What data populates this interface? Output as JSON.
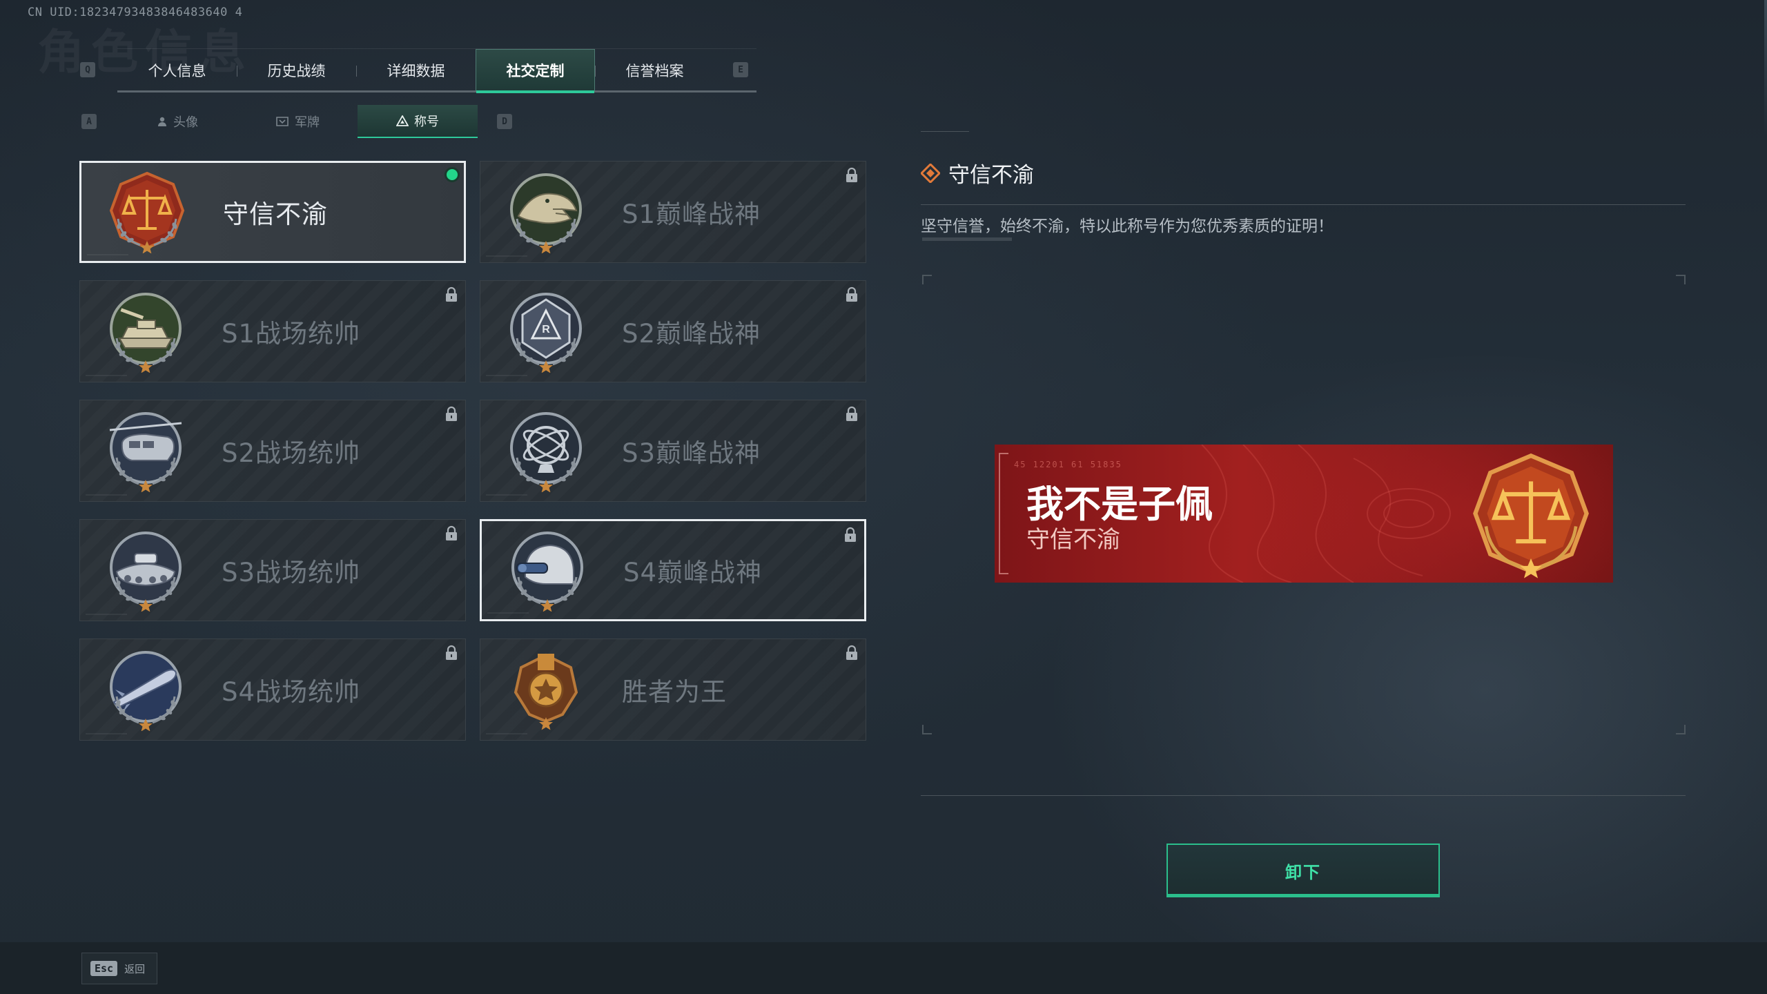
{
  "header": {
    "uid": "CN UID:18234793483846483640 4",
    "bg_title": "角色信息"
  },
  "main_tabs": {
    "prev_key": "Q",
    "next_key": "E",
    "items": [
      {
        "label": "个人信息"
      },
      {
        "label": "历史战绩"
      },
      {
        "label": "详细数据"
      },
      {
        "label": "社交定制"
      },
      {
        "label": "信誉档案"
      }
    ],
    "active_index": 3
  },
  "sub_tabs": {
    "prev_key": "A",
    "next_key": "D",
    "items": [
      {
        "label": "头像",
        "icon": "person-icon"
      },
      {
        "label": "军牌",
        "icon": "dogtag-icon"
      },
      {
        "label": "称号",
        "icon": "title-icon"
      }
    ],
    "active_index": 2
  },
  "titles": [
    {
      "label": "守信不渝",
      "badge": "scales-badge",
      "locked": false,
      "equipped": true
    },
    {
      "label": "S1巅峰战神",
      "badge": "crocodile-badge",
      "locked": true
    },
    {
      "label": "S1战场统帅",
      "badge": "tank-badge",
      "locked": true
    },
    {
      "label": "S2巅峰战神",
      "badge": "shield-badge",
      "locked": true
    },
    {
      "label": "S2战场统帅",
      "badge": "helicopter-badge",
      "locked": true
    },
    {
      "label": "S3巅峰战神",
      "badge": "globe-badge",
      "locked": true
    },
    {
      "label": "S3战场统帅",
      "badge": "hovercraft-badge",
      "locked": true
    },
    {
      "label": "S4巅峰战神",
      "badge": "helmet-badge",
      "locked": true,
      "hovered": true
    },
    {
      "label": "S4战场统帅",
      "badge": "missile-badge",
      "locked": true
    },
    {
      "label": "胜者为王",
      "badge": "medal-badge",
      "locked": true
    }
  ],
  "detail": {
    "title": "守信不渝",
    "description": "坚守信誉，始终不渝，特以此称号作为您优秀素质的证明！",
    "nameplate": {
      "player_name": "我不是子佩",
      "player_title": "守信不渝",
      "code": "45 12201  61 51835"
    },
    "unequip_label": "卸下"
  },
  "footer": {
    "esc_key": "Esc",
    "back_label": "返回"
  },
  "colors": {
    "accent_green": "#2ec99a",
    "equipped_dot": "#23d58a",
    "nameplate_red": "#a2201f"
  }
}
